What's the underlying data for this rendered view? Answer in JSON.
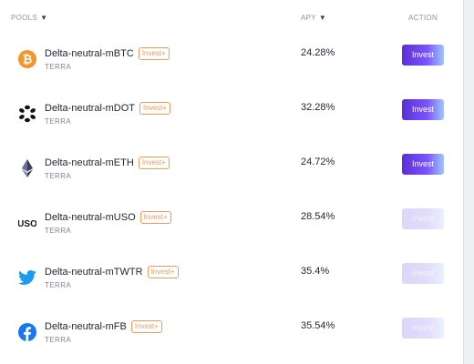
{
  "table": {
    "headers": {
      "pools": "POOLS",
      "apy": "APY",
      "action": "ACTION"
    },
    "sort_caret": "▼",
    "rows": [
      {
        "icon": "bitcoin-icon",
        "name": "Delta-neutral-mBTC",
        "tag": "Invest+",
        "chain": "TERRA",
        "apy": "24.28%",
        "action": "Invest",
        "enabled": true
      },
      {
        "icon": "polkadot-icon",
        "name": "Delta-neutral-mDOT",
        "tag": "Invest+",
        "chain": "TERRA",
        "apy": "32.28%",
        "action": "Invest",
        "enabled": true
      },
      {
        "icon": "ethereum-icon",
        "name": "Delta-neutral-mETH",
        "tag": "Invest+",
        "chain": "TERRA",
        "apy": "24.72%",
        "action": "Invest",
        "enabled": true
      },
      {
        "icon": "uso-icon",
        "name": "Delta-neutral-mUSO",
        "tag": "Invest+",
        "chain": "TERRA",
        "apy": "28.54%",
        "action": "Invest",
        "enabled": false
      },
      {
        "icon": "twitter-icon",
        "name": "Delta-neutral-mTWTR",
        "tag": "Invest+",
        "chain": "TERRA",
        "apy": "35.4%",
        "action": "Invest",
        "enabled": false
      },
      {
        "icon": "facebook-icon",
        "name": "Delta-neutral-mFB",
        "tag": "Invest+",
        "chain": "TERRA",
        "apy": "35.54%",
        "action": "Invest",
        "enabled": false
      }
    ]
  },
  "colors": {
    "accent": "#6a3ff0",
    "tag": "#f29a5c",
    "header_text": "#8a93a6"
  },
  "uso_label": "USO"
}
